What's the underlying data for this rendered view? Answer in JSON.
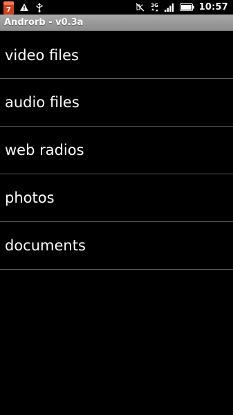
{
  "status_bar": {
    "calendar_day": "7",
    "network_type": "3G",
    "time": "10:57",
    "icons": [
      "calendar-icon",
      "warning-icon",
      "usb-icon",
      "mute-icon",
      "signal-icon",
      "battery-icon"
    ]
  },
  "app": {
    "title": "Androrb - v0.3a"
  },
  "menu": {
    "items": [
      {
        "label": "video files"
      },
      {
        "label": "audio files"
      },
      {
        "label": "web radios"
      },
      {
        "label": "photos"
      },
      {
        "label": "documents"
      }
    ]
  },
  "colors": {
    "background": "#000000",
    "title_bar": "#9c9c9c",
    "divider": "#5c5c5c",
    "calendar_icon": "#d2401e"
  }
}
